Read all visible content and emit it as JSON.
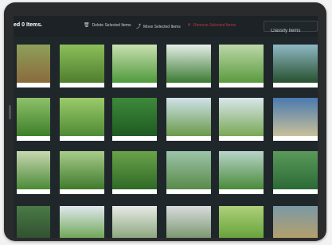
{
  "toolbar": {
    "title": "ed 0 Items.",
    "delete_label": "Delete Selected Items",
    "move_label": "Move Selected Items",
    "remove_label": "Remove Selected Items",
    "search_placeholder": "Classify Items"
  },
  "icons": {
    "delete": "trash-icon",
    "move": "move-icon",
    "remove": "close-icon"
  },
  "colors": {
    "screen_bg": "#20272b",
    "toolbar_bg": "#1c2226",
    "danger": "#b83a3a",
    "tile_border": "#ffffff"
  },
  "gallery": {
    "rows": [
      [
        {
          "name": "soil-seedlings",
          "top": "#8ea05a",
          "bottom": "#8a6a3c"
        },
        {
          "name": "leafy-plants",
          "top": "#8cbf5a",
          "bottom": "#4f7d2e"
        },
        {
          "name": "crop-rows-field",
          "top": "#c9e0b0",
          "bottom": "#4f9a3c"
        },
        {
          "name": "green-field-horizon",
          "top": "#e4eee6",
          "bottom": "#3c7a32"
        },
        {
          "name": "green-meadow",
          "top": "#bcd8a8",
          "bottom": "#5a9a3e"
        },
        {
          "name": "dark-crop-rows",
          "top": "#8fb8c4",
          "bottom": "#26502e"
        }
      ],
      [
        {
          "name": "tall-grass",
          "top": "#8ec06a",
          "bottom": "#3f7f2a"
        },
        {
          "name": "vegetable-patch",
          "top": "#9acb6a",
          "bottom": "#4f8a34"
        },
        {
          "name": "green-leaves-closeup",
          "top": "#3d8a3a",
          "bottom": "#1f5a22"
        },
        {
          "name": "wheat-stalks",
          "top": "#cfe2e8",
          "bottom": "#6a9a4a"
        },
        {
          "name": "wheat-ears",
          "top": "#d8e6ea",
          "bottom": "#7aa856"
        },
        {
          "name": "sky-and-grass",
          "top": "#4a7ab0",
          "bottom": "#c9c09a"
        }
      ],
      [
        {
          "name": "field-rows-light",
          "top": "#c8d8b0",
          "bottom": "#4a8a36"
        },
        {
          "name": "lush-field",
          "top": "#a8cc8a",
          "bottom": "#3f7a2c"
        },
        {
          "name": "shrub-closeup",
          "top": "#6aa24a",
          "bottom": "#2f6a26"
        },
        {
          "name": "terraced-hills",
          "top": "#9cc4a8",
          "bottom": "#5a8a4a"
        },
        {
          "name": "tea-plantation",
          "top": "#b8d4c8",
          "bottom": "#4a8a3a"
        },
        {
          "name": "cabbage-leaves",
          "top": "#5a9a5a",
          "bottom": "#2c6a36"
        }
      ],
      [
        {
          "name": "dark-field-rows",
          "top": "#4a7a46",
          "bottom": "#2c4a2c"
        },
        {
          "name": "field-under-sky",
          "top": "#e0e8ee",
          "bottom": "#5a9a3a"
        },
        {
          "name": "greenhouse-rows",
          "top": "#e8eae6",
          "bottom": "#7a9a6a"
        },
        {
          "name": "greenhouse-interior",
          "top": "#d8dcde",
          "bottom": "#6a8a5a"
        },
        {
          "name": "bright-crops",
          "top": "#aed07a",
          "bottom": "#5a9a30"
        },
        {
          "name": "evening-field",
          "top": "#7a9aa6",
          "bottom": "#c0a060"
        }
      ]
    ]
  }
}
